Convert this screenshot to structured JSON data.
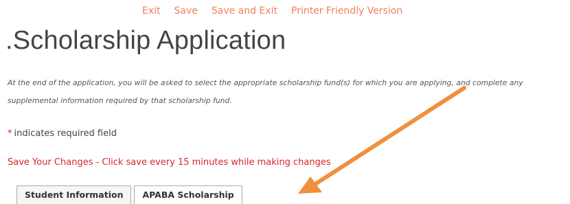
{
  "topnav": {
    "exit_label": "Exit",
    "save_label": "Save",
    "save_and_exit_label": "Save and Exit",
    "printer_label": "Printer Friendly Version"
  },
  "page_title": ".Scholarship Application",
  "intro_text": "At the end of the application, you will be asked to select the appropriate scholarship fund(s) for which you are applying, and complete any supplemental information required by that scholarship fund.",
  "required_note": {
    "star": "*",
    "text": "indicates required field"
  },
  "save_warning": "Save Your Changes - Click save every 15 minutes while making changes",
  "tabs": [
    {
      "label": "Student Information"
    },
    {
      "label": "APABA Scholarship"
    }
  ],
  "colors": {
    "link": "#f07f5a",
    "warning": "#d8242a",
    "arrow": "#f0903f"
  },
  "annotation": {
    "icon": "arrow-pointer-icon"
  }
}
